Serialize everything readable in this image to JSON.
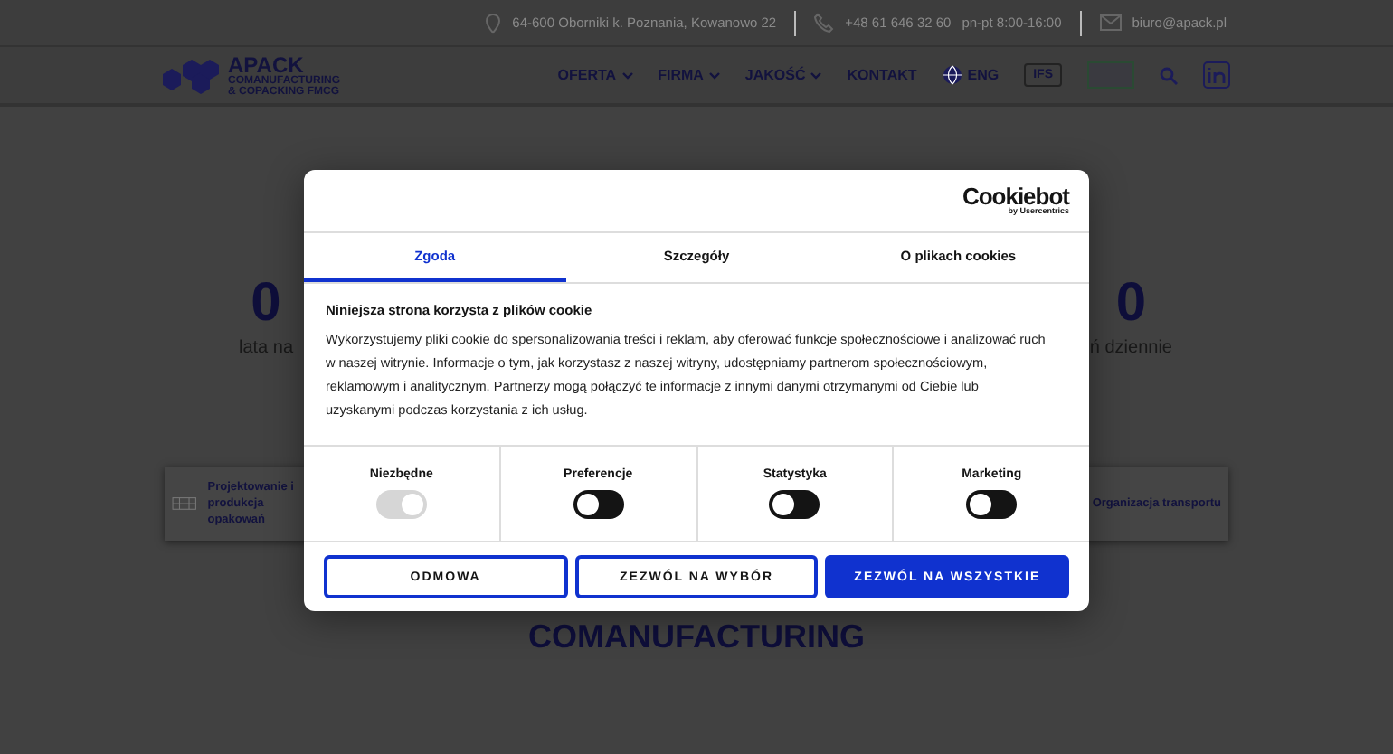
{
  "topbar": {
    "address": "64-600 Oborniki k. Poznania, Kowanowo 22",
    "phone": "+48 61 646 32 60",
    "hours": "pn-pt 8:00-16:00",
    "email": "biuro@apack.pl"
  },
  "header": {
    "logo": {
      "name": "APACK",
      "tagline_1": "COMANUFACTURING",
      "tagline_2": "& COPACKING FMCG"
    },
    "nav": [
      {
        "label": "OFERTA",
        "dropdown": true
      },
      {
        "label": "FIRMA",
        "dropdown": true
      },
      {
        "label": "JAKOŚĆ",
        "dropdown": true
      },
      {
        "label": "KONTAKT",
        "dropdown": false
      }
    ],
    "language": "ENG",
    "certificate": "IFS"
  },
  "stats": [
    {
      "number": "0",
      "caption": "lata na"
    },
    {
      "number": "0",
      "caption": "ń dziennie"
    }
  ],
  "services": [
    {
      "label": "Projektowanie i produkcja opakowań"
    },
    {
      "label": "Organizacja transportu"
    }
  ],
  "section_heading": "COMANUFACTURING",
  "cookie_dialog": {
    "brand": "Cookiebot",
    "brand_sub": "by Usercentrics",
    "tabs": [
      {
        "label": "Zgoda",
        "selected": true
      },
      {
        "label": "Szczegóły",
        "selected": false
      },
      {
        "label": "O plikach cookies",
        "selected": false
      }
    ],
    "title": "Niniejsza strona korzysta z plików cookie",
    "body": "Wykorzystujemy pliki cookie do spersonalizowania treści i reklam, aby oferować funkcje społecznościowe i analizować ruch w naszej witrynie. Informacje o tym, jak korzystasz z naszej witryny, udostępniamy partnerom społecznościowym, reklamowym i analitycznym. Partnerzy mogą połączyć te informacje z innymi danymi otrzymanymi od Ciebie lub uzyskanymi podczas korzystania z ich usług.",
    "toggles": [
      {
        "label": "Niezbędne",
        "checked": true,
        "disabled": true
      },
      {
        "label": "Preferencje",
        "checked": false,
        "disabled": false
      },
      {
        "label": "Statystyka",
        "checked": false,
        "disabled": false
      },
      {
        "label": "Marketing",
        "checked": false,
        "disabled": false
      }
    ],
    "buttons": [
      {
        "label": "ODMOWA",
        "kind": "outline"
      },
      {
        "label": "ZEZWÓL NA WYBÓR",
        "kind": "outline"
      },
      {
        "label": "ZEZWÓL NA WSZYSTKIE",
        "kind": "primary"
      }
    ]
  }
}
